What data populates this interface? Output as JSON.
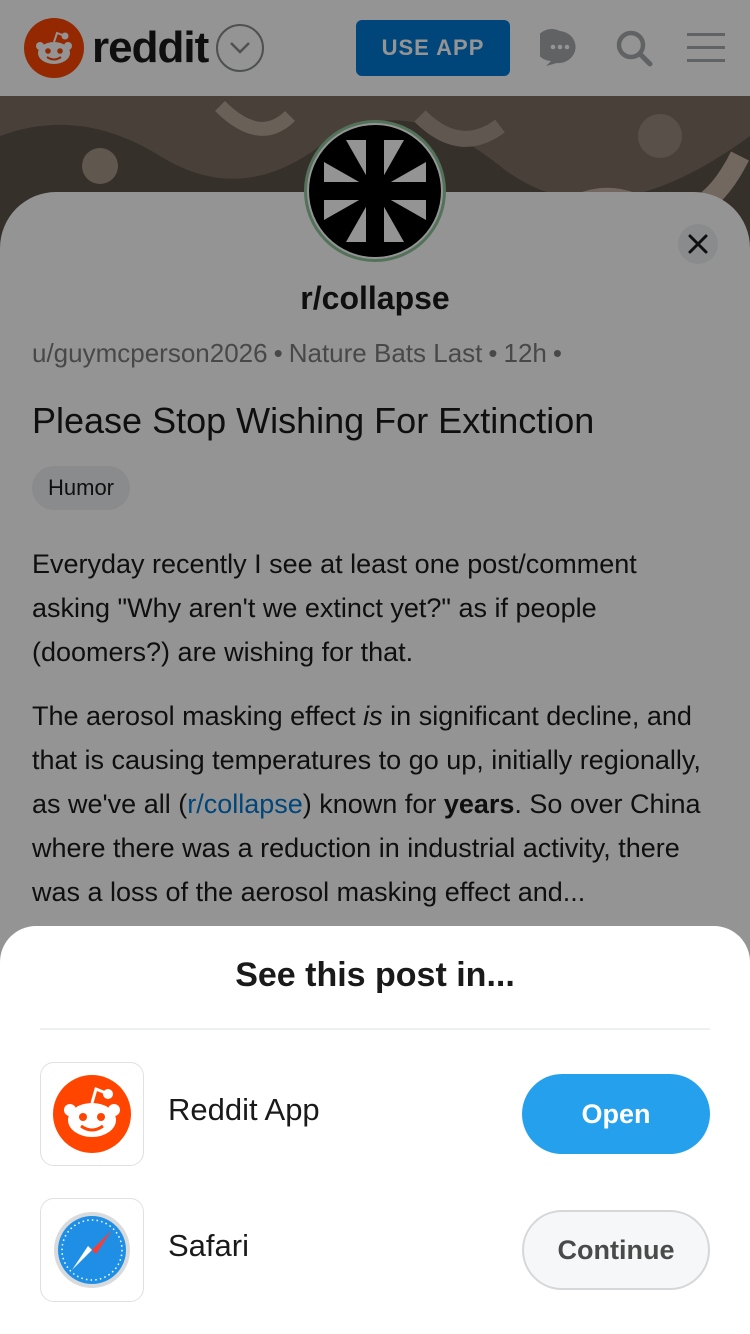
{
  "header": {
    "logo_text": "reddit",
    "use_app_label": "USE APP",
    "brand_color": "#ff4500",
    "icons": [
      "reddit-alien-icon",
      "chevron-down-icon",
      "chat-icon",
      "search-icon",
      "menu-icon"
    ]
  },
  "post": {
    "subreddit": "r/collapse",
    "author": "u/guymcperson2026",
    "flair_user": "Nature Bats Last",
    "age": "12h",
    "title": "Please Stop Wishing For Extinction",
    "flair": "Humor",
    "p1": "Everyday recently I see at least one post/comment asking \"Why aren't we extinct yet?\" as if people (doomers?) are wishing for that.",
    "p2_a": "The aerosol masking effect ",
    "p2_em": "is",
    "p2_b": " in significant decline, and that is causing temperatures to go up, initially regionally, as we've all (",
    "p2_link": "r/collapse",
    "p2_c": ") known for ",
    "p2_strong": "years",
    "p2_d": ". So over China where there was a reduction in industrial activity, there was a loss of the aerosol masking effect and..."
  },
  "sheet": {
    "title": "See this post in...",
    "apps": [
      {
        "name": "Reddit App",
        "action": "Open"
      },
      {
        "name": "Safari",
        "action": "Continue"
      }
    ]
  }
}
